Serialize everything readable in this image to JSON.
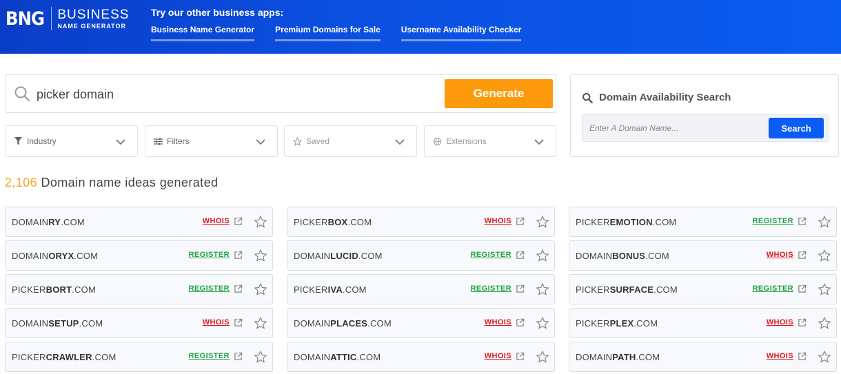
{
  "header": {
    "logo_mark": "BNG",
    "logo_line1": "BUSINESS",
    "logo_line2": "NAME GENERATOR",
    "apps_title": "Try our other business apps:",
    "apps": [
      "Business Name Generator",
      "Premium Domains for Sale",
      "Username Availability Checker"
    ]
  },
  "search": {
    "value": "picker domain",
    "generate_label": "Generate"
  },
  "filters": [
    {
      "label": "Industry",
      "icon": "filter-icon"
    },
    {
      "label": "Filters",
      "icon": "sliders-icon"
    },
    {
      "label": "Saved",
      "icon": "star-icon"
    },
    {
      "label": "Extensions",
      "icon": "globe-icon"
    }
  ],
  "availability": {
    "title": "Domain Availability Search",
    "placeholder": "Enter A Domain Name...",
    "button": "Search"
  },
  "results": {
    "count": "2,106",
    "text": "Domain name ideas generated",
    "items": [
      {
        "prefix": "DOMAIN",
        "bold": "RY",
        "tld": ".COM",
        "action": "WHOIS"
      },
      {
        "prefix": "PICKER",
        "bold": "BOX",
        "tld": ".COM",
        "action": "WHOIS"
      },
      {
        "prefix": "PICKER",
        "bold": "EMOTION",
        "tld": ".COM",
        "action": "REGISTER"
      },
      {
        "prefix": "DOMAIN",
        "bold": "ORYX",
        "tld": ".COM",
        "action": "REGISTER"
      },
      {
        "prefix": "DOMAIN",
        "bold": "LUCID",
        "tld": ".COM",
        "action": "REGISTER"
      },
      {
        "prefix": "DOMAIN",
        "bold": "BONUS",
        "tld": ".COM",
        "action": "WHOIS"
      },
      {
        "prefix": "PICKER",
        "bold": "BORT",
        "tld": ".COM",
        "action": "REGISTER"
      },
      {
        "prefix": "PICKER",
        "bold": "IVA",
        "tld": ".COM",
        "action": "REGISTER"
      },
      {
        "prefix": "PICKER",
        "bold": "SURFACE",
        "tld": ".COM",
        "action": "REGISTER"
      },
      {
        "prefix": "DOMAIN",
        "bold": "SETUP",
        "tld": ".COM",
        "action": "WHOIS"
      },
      {
        "prefix": "DOMAIN",
        "bold": "PLACES",
        "tld": ".COM",
        "action": "WHOIS"
      },
      {
        "prefix": "PICKER",
        "bold": "PLEX",
        "tld": ".COM",
        "action": "WHOIS"
      },
      {
        "prefix": "PICKER",
        "bold": "CRAWLER",
        "tld": ".COM",
        "action": "REGISTER"
      },
      {
        "prefix": "DOMAIN",
        "bold": "ATTIC",
        "tld": ".COM",
        "action": "WHOIS"
      },
      {
        "prefix": "DOMAIN",
        "bold": "PATH",
        "tld": ".COM",
        "action": "WHOIS"
      }
    ]
  },
  "colors": {
    "header_blue": "#0b4fe0",
    "generate_orange": "#fd9a0c",
    "search_blue": "#0a5cf5",
    "whois_red": "#e0151a",
    "register_green": "#21a244",
    "count_orange": "#f5a623"
  }
}
